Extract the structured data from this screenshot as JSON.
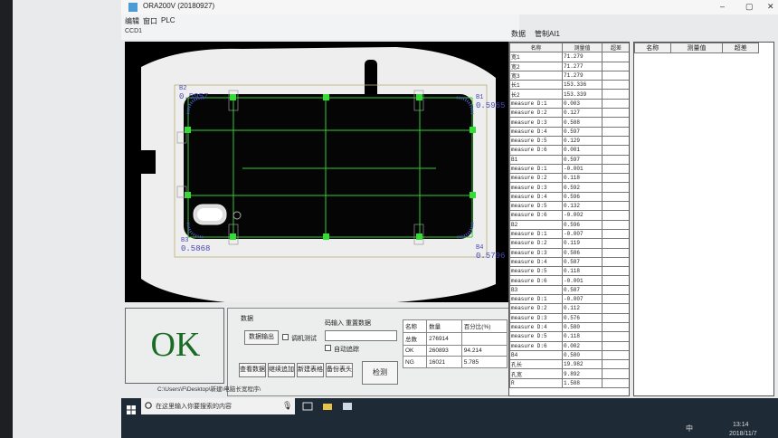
{
  "window": {
    "title": "ORA200V (20180927)",
    "minimize": "–",
    "maximize": "▢",
    "close": "✕"
  },
  "menu": {
    "items": [
      "编辑",
      "窗口",
      "PLC"
    ],
    "ccd_label": "CCD1"
  },
  "camera": {
    "labels": [
      {
        "id": "B2",
        "value": "0.5957"
      },
      {
        "id": "B1",
        "value": "0.5965"
      },
      {
        "id": "B3",
        "value": "0.5868"
      },
      {
        "id": "B4",
        "value": "0.5796"
      }
    ]
  },
  "result": {
    "text": "OK",
    "color": "#1a6b26"
  },
  "data_panel": {
    "title": "数据",
    "export_button": "数据输出",
    "debug_checkbox_label": "调机测试",
    "input_label": "码输入",
    "reset_button_label": "重置数据",
    "auto_fill_label": "自动追踪",
    "view_button": "查看数据",
    "continue_button": "继续追加",
    "new_button": "新建表格",
    "save_button": "备份表头",
    "detect_button": "检测"
  },
  "stats": {
    "headers": [
      "名称",
      "数量",
      "百分比(%)"
    ],
    "rows": [
      [
        "总数",
        "276914",
        ""
      ],
      [
        "OK",
        "260893",
        "94.214"
      ],
      [
        "NG",
        "16021",
        "5.785"
      ]
    ]
  },
  "path": "C:\\Users\\F\\Desktop\\新建\\电脑长宽程序\\",
  "tabs": [
    "数据",
    "管制AI1"
  ],
  "measure_table": {
    "headers": [
      "名称",
      "测量值",
      "超差"
    ],
    "rows": [
      [
        "宽1",
        "71.279",
        ""
      ],
      [
        "宽2",
        "71.277",
        ""
      ],
      [
        "宽3",
        "71.279",
        ""
      ],
      [
        "长1",
        "153.336",
        ""
      ],
      [
        "长2",
        "153.339",
        ""
      ],
      [
        "measure D:1",
        "0.003",
        ""
      ],
      [
        "measure D:2",
        "0.127",
        ""
      ],
      [
        "measure D:3",
        "0.588",
        ""
      ],
      [
        "measure D:4",
        "0.597",
        ""
      ],
      [
        "measure D:5",
        "0.129",
        ""
      ],
      [
        "measure D:6",
        "0.001",
        ""
      ],
      [
        "B1",
        "0.597",
        ""
      ],
      [
        "measure D:1",
        "-0.001",
        ""
      ],
      [
        "measure D:2",
        "0.118",
        ""
      ],
      [
        "measure D:3",
        "0.592",
        ""
      ],
      [
        "measure D:4",
        "0.596",
        ""
      ],
      [
        "measure D:5",
        "0.132",
        ""
      ],
      [
        "measure D:6",
        "-0.002",
        ""
      ],
      [
        "B2",
        "0.596",
        ""
      ],
      [
        "measure D:1",
        "-0.007",
        ""
      ],
      [
        "measure D:2",
        "0.119",
        ""
      ],
      [
        "measure D:3",
        "0.586",
        ""
      ],
      [
        "measure D:4",
        "0.587",
        ""
      ],
      [
        "measure D:5",
        "0.118",
        ""
      ],
      [
        "measure D:6",
        "-0.001",
        ""
      ],
      [
        "B3",
        "0.587",
        ""
      ],
      [
        "measure D:1",
        "-0.007",
        ""
      ],
      [
        "measure D:2",
        "0.112",
        ""
      ],
      [
        "measure D:3",
        "0.576",
        ""
      ],
      [
        "measure D:4",
        "0.580",
        ""
      ],
      [
        "measure D:5",
        "0.118",
        ""
      ],
      [
        "measure D:6",
        "0.002",
        ""
      ],
      [
        "B4",
        "0.580",
        ""
      ],
      [
        "孔长",
        "19.982",
        ""
      ],
      [
        "孔宽",
        "9.892",
        ""
      ],
      [
        "R",
        "1.588",
        ""
      ]
    ]
  },
  "side_table": {
    "headers": [
      "名称",
      "测量值",
      "超差"
    ]
  },
  "taskbar": {
    "search_placeholder": "在这里输入你要搜索的内容",
    "time": "13:14",
    "date": "2018/11/7",
    "ime": "中"
  }
}
